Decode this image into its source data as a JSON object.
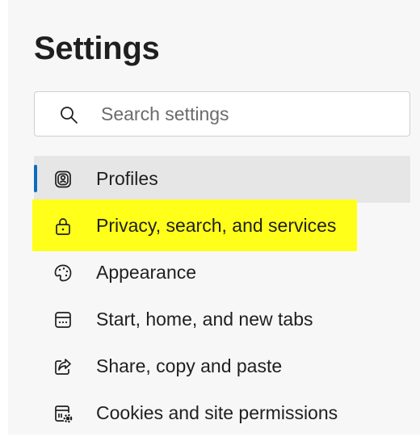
{
  "header": {
    "title": "Settings"
  },
  "search": {
    "placeholder": "Search settings",
    "icon": "search-icon"
  },
  "highlight_color": "#ffff1a",
  "accent_color": "#0f6cbd",
  "sidebar": {
    "items": [
      {
        "label": "Profiles",
        "icon": "profile-icon",
        "selected": true
      },
      {
        "label": "Privacy, search, and services",
        "icon": "lock-icon",
        "highlighted": true
      },
      {
        "label": "Appearance",
        "icon": "palette-icon"
      },
      {
        "label": "Start, home, and new tabs",
        "icon": "new-tab-icon"
      },
      {
        "label": "Share, copy and paste",
        "icon": "share-icon"
      },
      {
        "label": "Cookies and site permissions",
        "icon": "site-permissions-icon"
      }
    ]
  }
}
